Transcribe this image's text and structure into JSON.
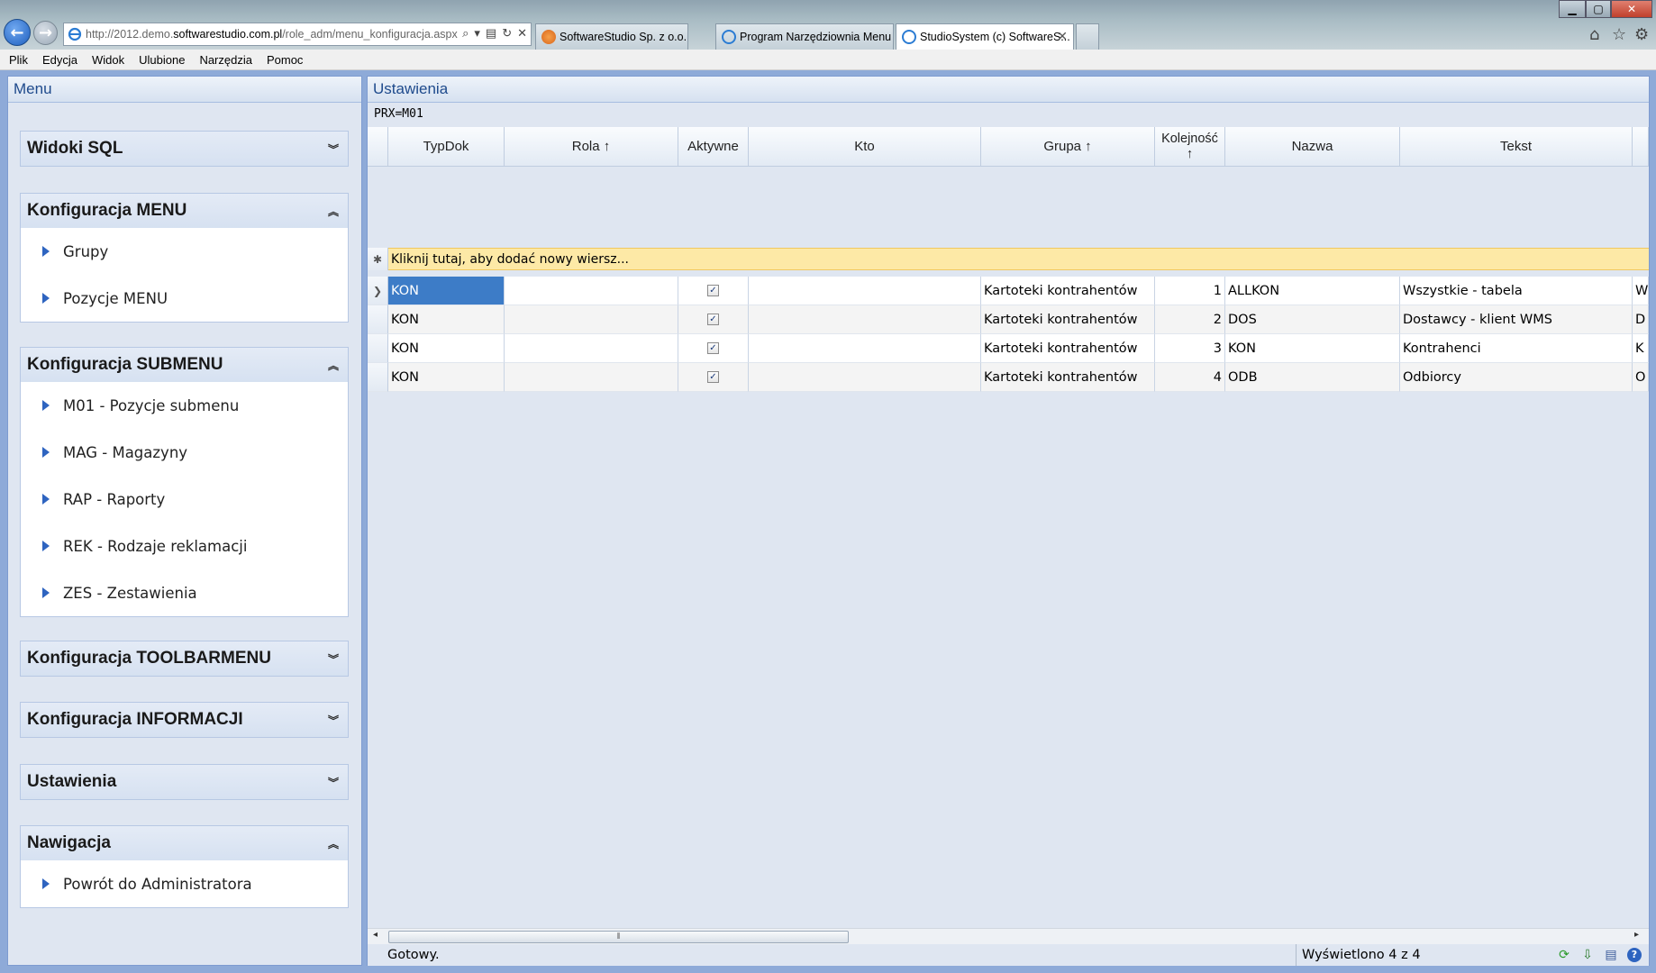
{
  "browser": {
    "url_prefix": "http://2012.demo.",
    "url_host": "softwarestudio.com.pl",
    "url_suffix": "/role_adm/menu_konfiguracja.aspx",
    "tabs": [
      {
        "label": "SoftwareStudio Sp. z o.o. prod..."
      },
      {
        "label": "Program Narzędziownia Menu"
      },
      {
        "label": "StudioSystem (c) SoftwareS..."
      }
    ],
    "menu": [
      "Plik",
      "Edycja",
      "Widok",
      "Ulubione",
      "Narzędzia",
      "Pomoc"
    ]
  },
  "sidebar": {
    "title": "Menu",
    "groups": [
      {
        "title": "Widoki SQL",
        "expanded": false,
        "items": []
      },
      {
        "title": "Konfiguracja MENU",
        "expanded": true,
        "items": [
          "Grupy",
          "Pozycje MENU"
        ]
      },
      {
        "title": "Konfiguracja SUBMENU",
        "expanded": true,
        "items": [
          "M01 - Pozycje submenu",
          "MAG - Magazyny",
          "RAP - Raporty",
          "REK - Rodzaje reklamacji",
          "ZES - Zestawienia"
        ]
      },
      {
        "title": "Konfiguracja TOOLBARMENU",
        "expanded": false,
        "items": []
      },
      {
        "title": "Konfiguracja INFORMACJI",
        "expanded": false,
        "items": []
      },
      {
        "title": "Ustawienia",
        "expanded": false,
        "items": []
      },
      {
        "title": "Nawigacja",
        "expanded": true,
        "items": [
          "Powrót do Administratora"
        ]
      }
    ]
  },
  "main": {
    "title": "Ustawienia",
    "filter": "PRX=M01",
    "columns": [
      "TypDok",
      "Rola ↑",
      "Aktywne",
      "Kto",
      "Grupa ↑",
      "Kolejność ↑",
      "Nazwa",
      "Tekst"
    ],
    "add_row_text": "Kliknij tutaj, aby dodać nowy wiersz...",
    "rows": [
      {
        "typdok": "KON",
        "rola": "",
        "aktywne": true,
        "kto": "",
        "grupa": "Kartoteki kontrahentów",
        "kolejnosc": "1",
        "nazwa": "ALLKON",
        "tekst": "Wszystkie - tabela",
        "extra": "W"
      },
      {
        "typdok": "KON",
        "rola": "",
        "aktywne": true,
        "kto": "",
        "grupa": "Kartoteki kontrahentów",
        "kolejnosc": "2",
        "nazwa": "DOS",
        "tekst": "Dostawcy - klient WMS",
        "extra": "D"
      },
      {
        "typdok": "KON",
        "rola": "",
        "aktywne": true,
        "kto": "",
        "grupa": "Kartoteki kontrahentów",
        "kolejnosc": "3",
        "nazwa": "KON",
        "tekst": "Kontrahenci",
        "extra": "K"
      },
      {
        "typdok": "KON",
        "rola": "",
        "aktywne": true,
        "kto": "",
        "grupa": "Kartoteki kontrahentów",
        "kolejnosc": "4",
        "nazwa": "ODB",
        "tekst": "Odbiorcy",
        "extra": "O"
      }
    ],
    "status": "Gotowy.",
    "count_text": "Wyświetlono 4 z 4"
  },
  "colors": {
    "accent": "#3d7cc7",
    "panel_bg": "#dfe6f1",
    "add_row": "#fde9a6"
  }
}
